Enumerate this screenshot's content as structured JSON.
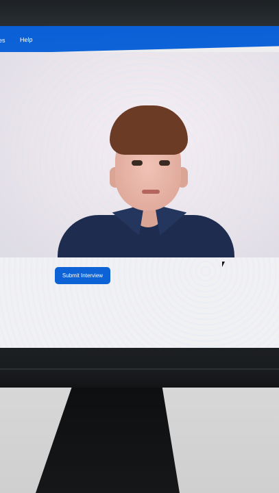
{
  "nav": {
    "partial_item": "es",
    "help": "Help"
  },
  "actions": {
    "submit_label": "Submit Interview"
  },
  "colors": {
    "accent": "#0d63d6"
  }
}
